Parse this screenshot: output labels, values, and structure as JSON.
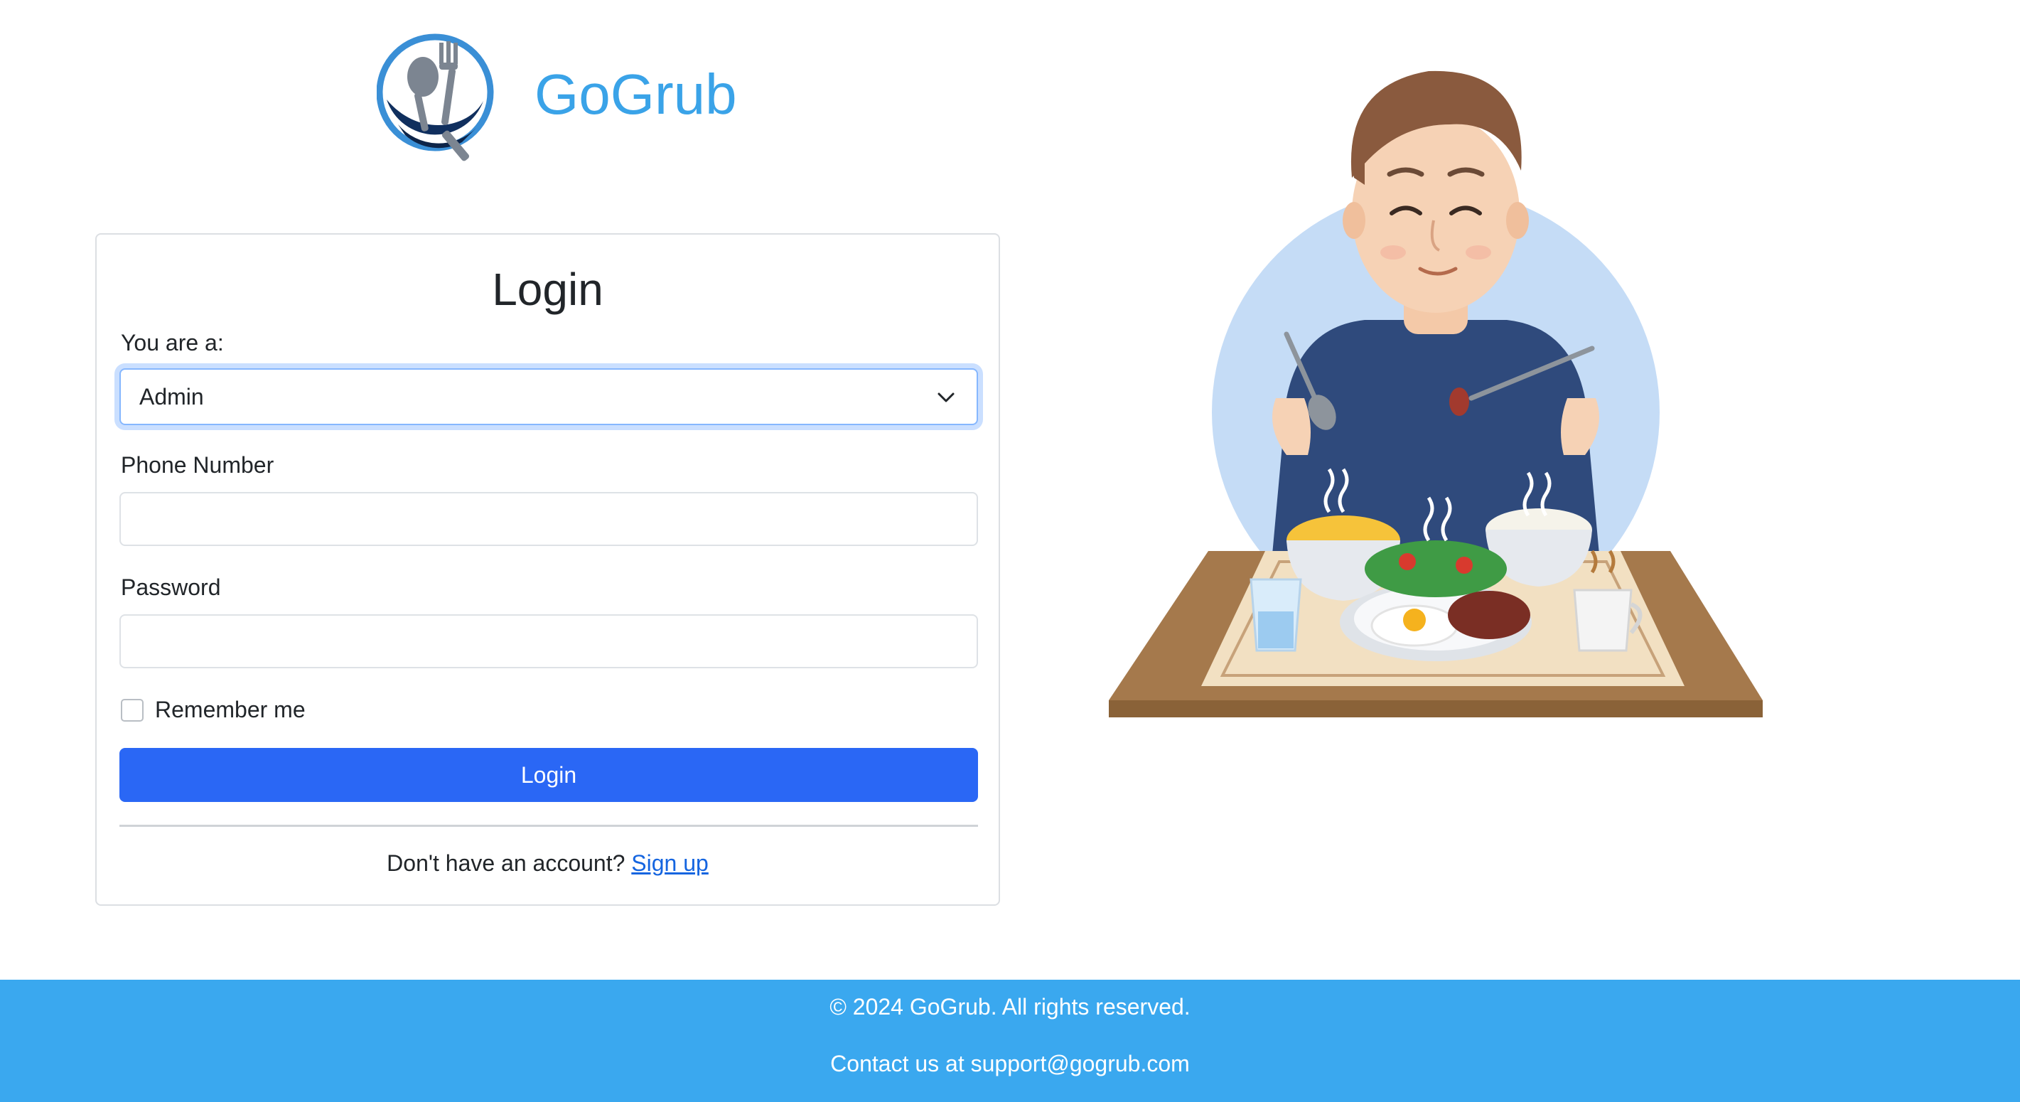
{
  "brand": {
    "name": "GoGrub",
    "logo_icon": "fork-spoon-logo-icon",
    "accent_color": "#3aa3e8"
  },
  "login_card": {
    "title": "Login",
    "role": {
      "label": "You are a:",
      "selected": "Admin"
    },
    "phone": {
      "label": "Phone Number",
      "value": ""
    },
    "password": {
      "label": "Password",
      "value": ""
    },
    "remember_me": {
      "label": "Remember me",
      "checked": false
    },
    "submit_label": "Login",
    "signup_prompt": "Don't have an account?",
    "signup_link": "Sign up",
    "button_color": "#2a67f5"
  },
  "illustration": {
    "icon": "man-eating-breakfast-illustration"
  },
  "footer": {
    "copyright": "© 2024 GoGrub. All rights reserved.",
    "contact": "Contact us at support@gogrub.com",
    "background": "#3aa8ef"
  }
}
